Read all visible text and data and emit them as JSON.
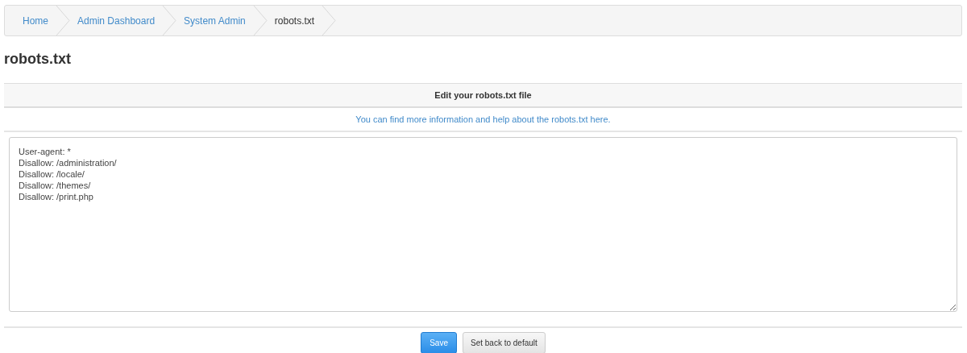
{
  "breadcrumb": [
    {
      "label": "Home",
      "active": false
    },
    {
      "label": "Admin Dashboard",
      "active": false
    },
    {
      "label": "System Admin",
      "active": false
    },
    {
      "label": "robots.txt",
      "active": true
    }
  ],
  "page_title": "robots.txt",
  "panel": {
    "heading": "Edit your robots.txt file",
    "help_link": "You can find more information and help about the robots.txt here.",
    "editor": {
      "value": "User-agent: *\nDisallow: /administration/\nDisallow: /locale/\nDisallow: /themes/\nDisallow: /print.php"
    }
  },
  "buttons": [
    {
      "label": "Save",
      "kind": "primary"
    },
    {
      "label": "Set back to default",
      "kind": "default"
    }
  ]
}
